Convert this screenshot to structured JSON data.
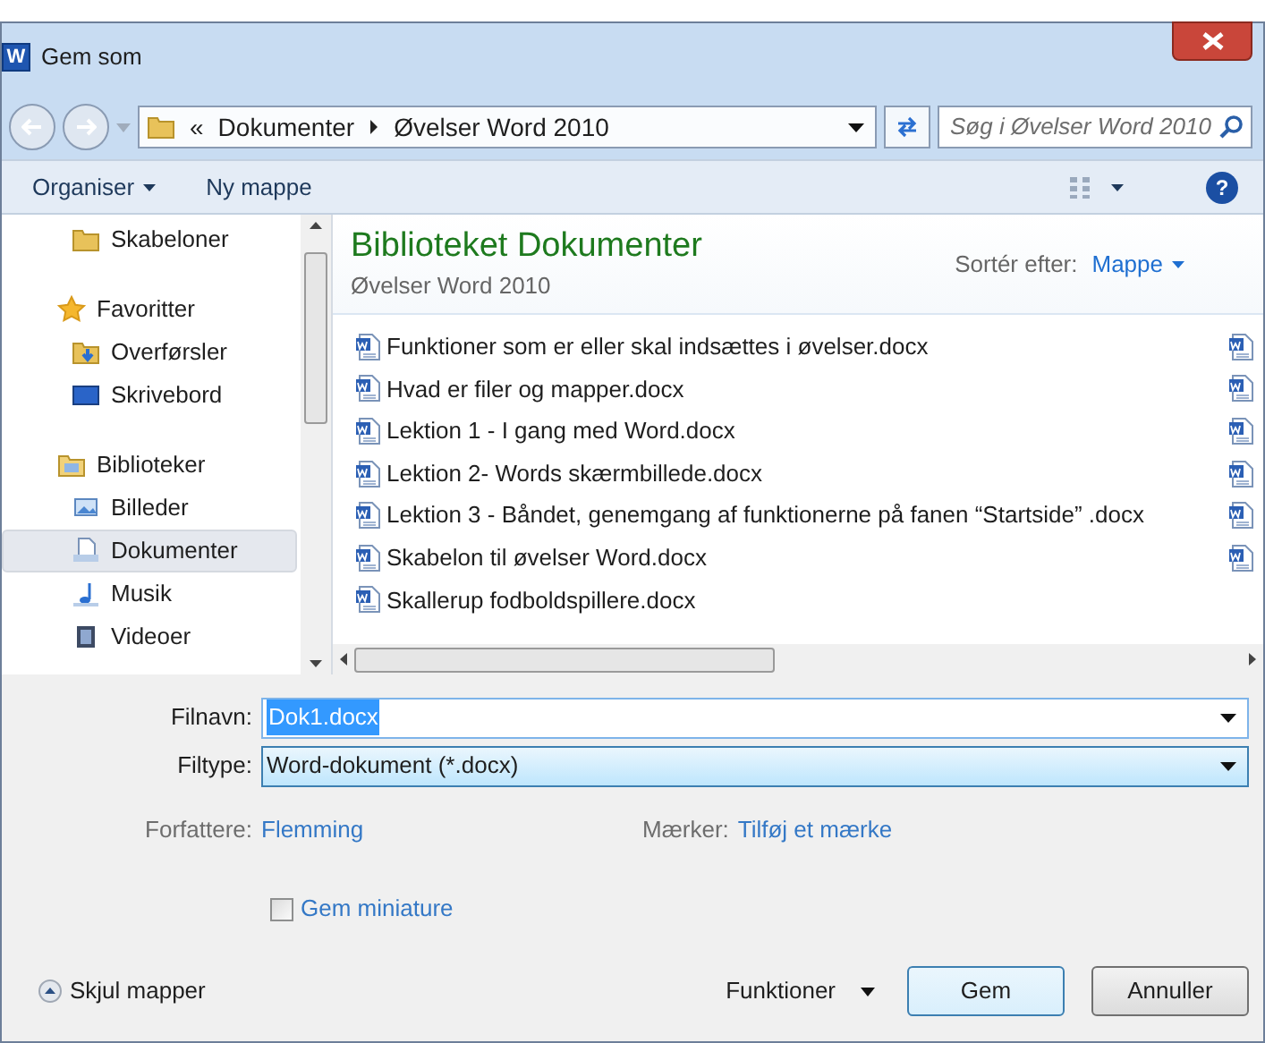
{
  "window": {
    "app_icon": "W",
    "title": "Gem som"
  },
  "address": {
    "overflow": "«",
    "path": [
      "Dokumenter",
      "Øvelser Word 2010"
    ],
    "search_placeholder": "Søg i Øvelser Word 2010"
  },
  "toolbar": {
    "organise": "Organiser",
    "new_folder": "Ny mappe",
    "help": "?"
  },
  "sidebar": {
    "sections": [
      {
        "children": [
          {
            "label": "Skabeloner",
            "kind": "folder",
            "selected": false
          }
        ]
      },
      {
        "label": "Favoritter",
        "kind": "star",
        "selected": false,
        "children": [
          {
            "label": "Overførsler",
            "kind": "download",
            "selected": false
          },
          {
            "label": "Skrivebord",
            "kind": "desktop",
            "selected": false
          }
        ]
      },
      {
        "label": "Biblioteker",
        "kind": "library",
        "selected": false,
        "children": [
          {
            "label": "Billeder",
            "kind": "pictures",
            "selected": false
          },
          {
            "label": "Dokumenter",
            "kind": "documents",
            "selected": true
          },
          {
            "label": "Musik",
            "kind": "music",
            "selected": false
          },
          {
            "label": "Videoer",
            "kind": "videos",
            "selected": false
          }
        ]
      }
    ]
  },
  "library": {
    "title": "Biblioteket Dokumenter",
    "subtitle": "Øvelser Word 2010",
    "sort_label": "Sortér efter:",
    "sort_value": "Mappe"
  },
  "files": [
    "Funktioner som er eller skal indsættes i øvelser.docx",
    "Hvad er filer og mapper.docx",
    "Lektion 1 - I gang med Word.docx",
    "Lektion 2- Words skærmbillede.docx",
    "Lektion 3 - Båndet, genemgang af funktionerne på fanen “Startside” .docx",
    "Skabelon til øvelser Word.docx",
    "Skallerup fodboldspillere.docx"
  ],
  "form": {
    "filename_label": "Filnavn:",
    "filename": "Dok1.docx",
    "filetype_label": "Filtype:",
    "filetype": "Word-dokument (*.docx)",
    "authors_label": "Forfattere:",
    "authors": "Flemming",
    "tags_label": "Mærker:",
    "tags": "Tilføj et mærke",
    "thumbnail_label": "Gem miniature",
    "thumbnail_checked": false
  },
  "footer": {
    "hide_folders": "Skjul mapper",
    "tools": "Funktioner",
    "save": "Gem",
    "cancel": "Annuller"
  }
}
